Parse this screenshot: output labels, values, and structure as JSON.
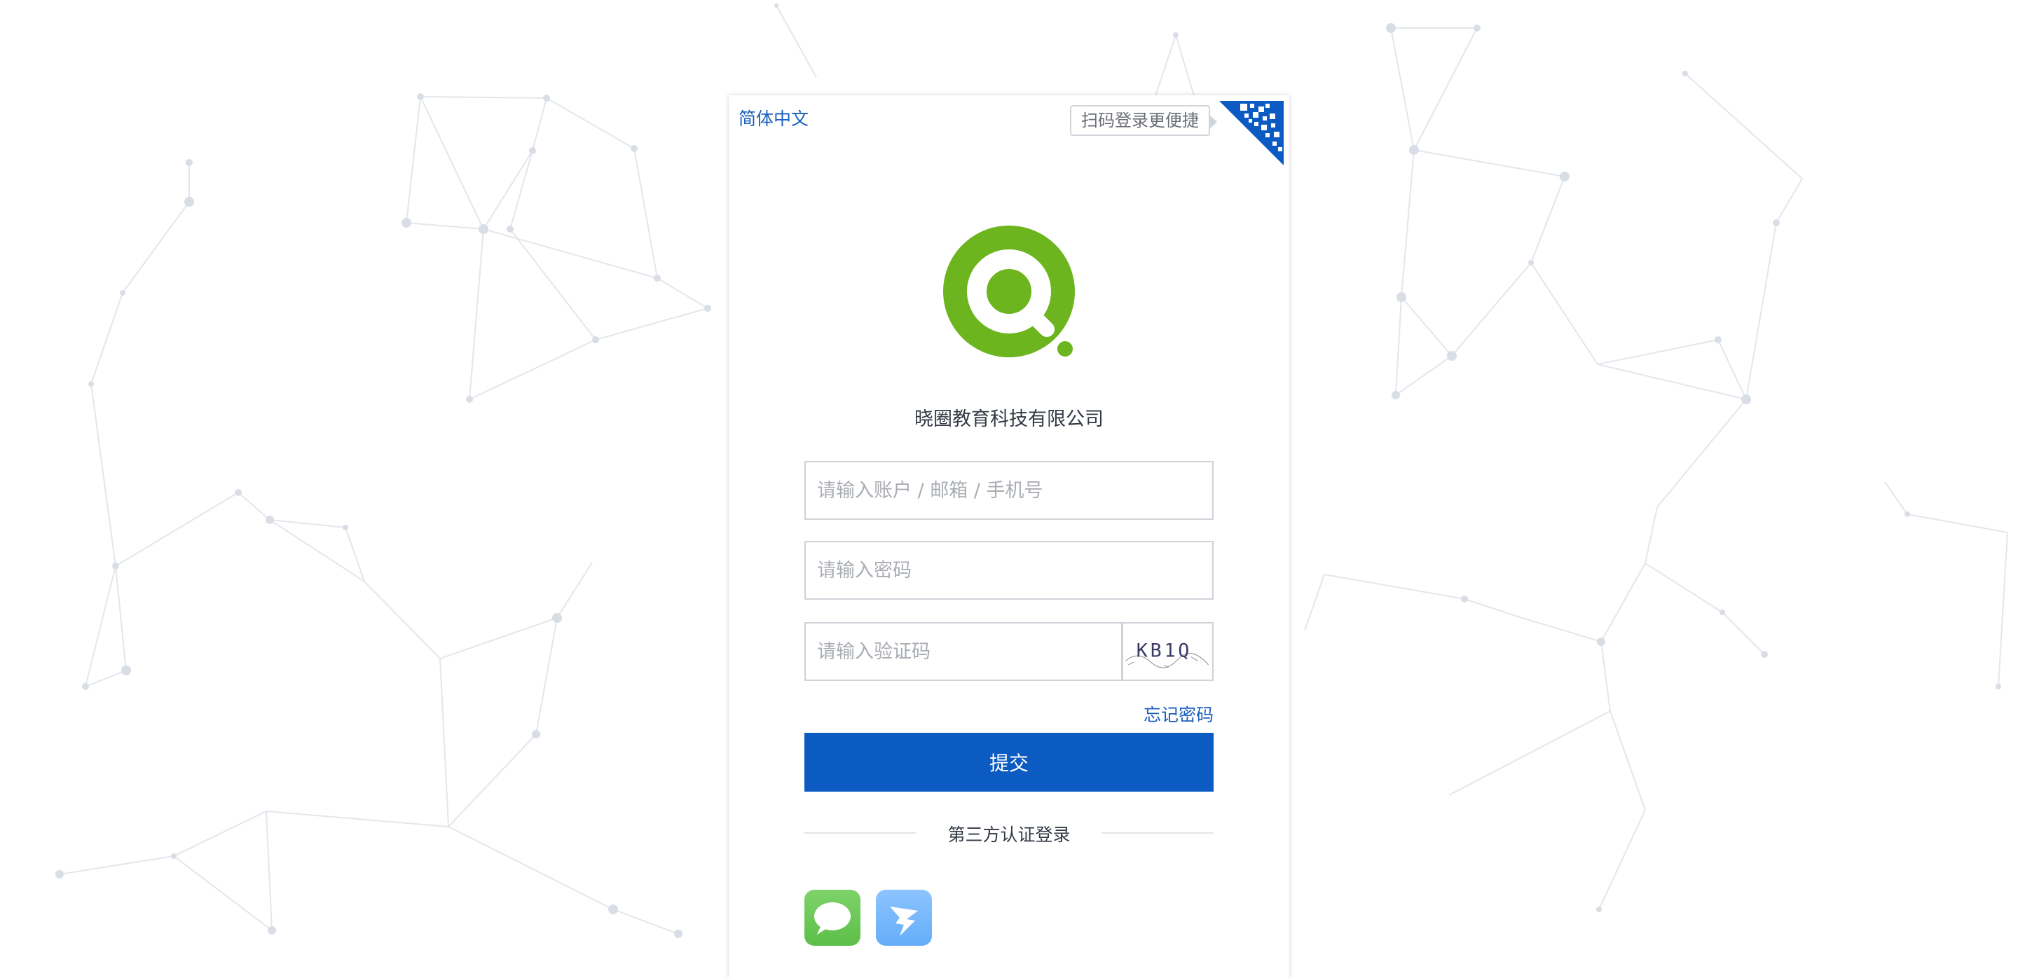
{
  "header": {
    "language": "简体中文",
    "qr_tip": "扫码登录更便捷"
  },
  "brand": {
    "company_name": "晓圈教育科技有限公司",
    "logo_color": "#6cb51f"
  },
  "form": {
    "username_placeholder": "请输入账户 / 邮箱 / 手机号",
    "password_placeholder": "请输入密码",
    "captcha_placeholder": "请输入验证码",
    "captcha_text": "KB1Q",
    "forgot_password": "忘记密码",
    "submit": "提交"
  },
  "third_party": {
    "title": "第三方认证登录",
    "providers": [
      "sms-icon",
      "dingtalk-icon"
    ]
  },
  "colors": {
    "primary": "#0b5bc3",
    "link": "#1a5fbf",
    "sms": "#6ccb58",
    "dingtalk": "#7bbcff"
  }
}
